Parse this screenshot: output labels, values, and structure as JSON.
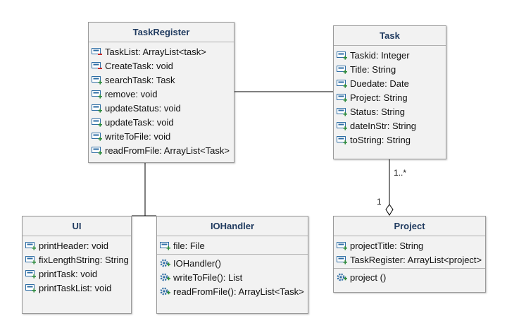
{
  "classes": [
    {
      "name": "TaskRegister",
      "members": [
        {
          "text": "TaskList: ArrayList<task>",
          "icon": "private-field-icon"
        },
        {
          "text": "CreateTask: void",
          "icon": "private-field-icon"
        },
        {
          "text": "searchTask: Task",
          "icon": "public-field-icon"
        },
        {
          "text": "remove: void",
          "icon": "public-field-icon"
        },
        {
          "text": "updateStatus: void",
          "icon": "public-field-icon"
        },
        {
          "text": "updateTask: void",
          "icon": "public-field-icon"
        },
        {
          "text": "writeToFile: void",
          "icon": "public-field-icon"
        },
        {
          "text": "readFromFile: ArrayList<Task>",
          "icon": "public-field-icon"
        }
      ]
    },
    {
      "name": "Task",
      "members": [
        {
          "text": "Taskid: Integer",
          "icon": "public-field-icon"
        },
        {
          "text": "Title: String",
          "icon": "public-field-icon"
        },
        {
          "text": "Duedate: Date",
          "icon": "public-field-icon"
        },
        {
          "text": "Project: String",
          "icon": "public-field-icon"
        },
        {
          "text": "Status: String",
          "icon": "public-field-icon"
        },
        {
          "text": "dateInStr: String",
          "icon": "public-field-icon"
        },
        {
          "text": "toString: String",
          "icon": "public-field-icon"
        }
      ]
    },
    {
      "name": "UI",
      "members": [
        {
          "text": "printHeader: void",
          "icon": "public-field-icon"
        },
        {
          "text": "fixLengthString: String",
          "icon": "public-field-icon"
        },
        {
          "text": "printTask: void",
          "icon": "public-field-icon"
        },
        {
          "text": "printTaskList: void",
          "icon": "public-field-icon"
        }
      ]
    },
    {
      "name": "IOHandler",
      "members": [
        {
          "text": "file: File",
          "icon": "public-field-icon"
        },
        {
          "text": "IOHandler()",
          "icon": "public-operation-icon",
          "separator": true
        },
        {
          "text": "writeToFile(): List",
          "icon": "public-operation-icon"
        },
        {
          "text": "readFromFile(): ArrayList<Task>",
          "icon": "public-operation-icon"
        }
      ]
    },
    {
      "name": "Project",
      "members": [
        {
          "text": "projectTitle: String",
          "icon": "public-field-icon"
        },
        {
          "text": "TaskRegister: ArrayList<project>",
          "icon": "public-field-icon"
        },
        {
          "text": "project ()",
          "icon": "public-operation-icon",
          "separator": true
        }
      ]
    }
  ],
  "multiplicities": {
    "task_end": "1..*",
    "project_end": "1"
  },
  "colors": {
    "class_name": "#1f3a5f",
    "box_fill": "#f2f2f2",
    "icon_blue": "#2e6da4",
    "public_marker": "#2e8b3e",
    "private_marker": "#c62828"
  }
}
